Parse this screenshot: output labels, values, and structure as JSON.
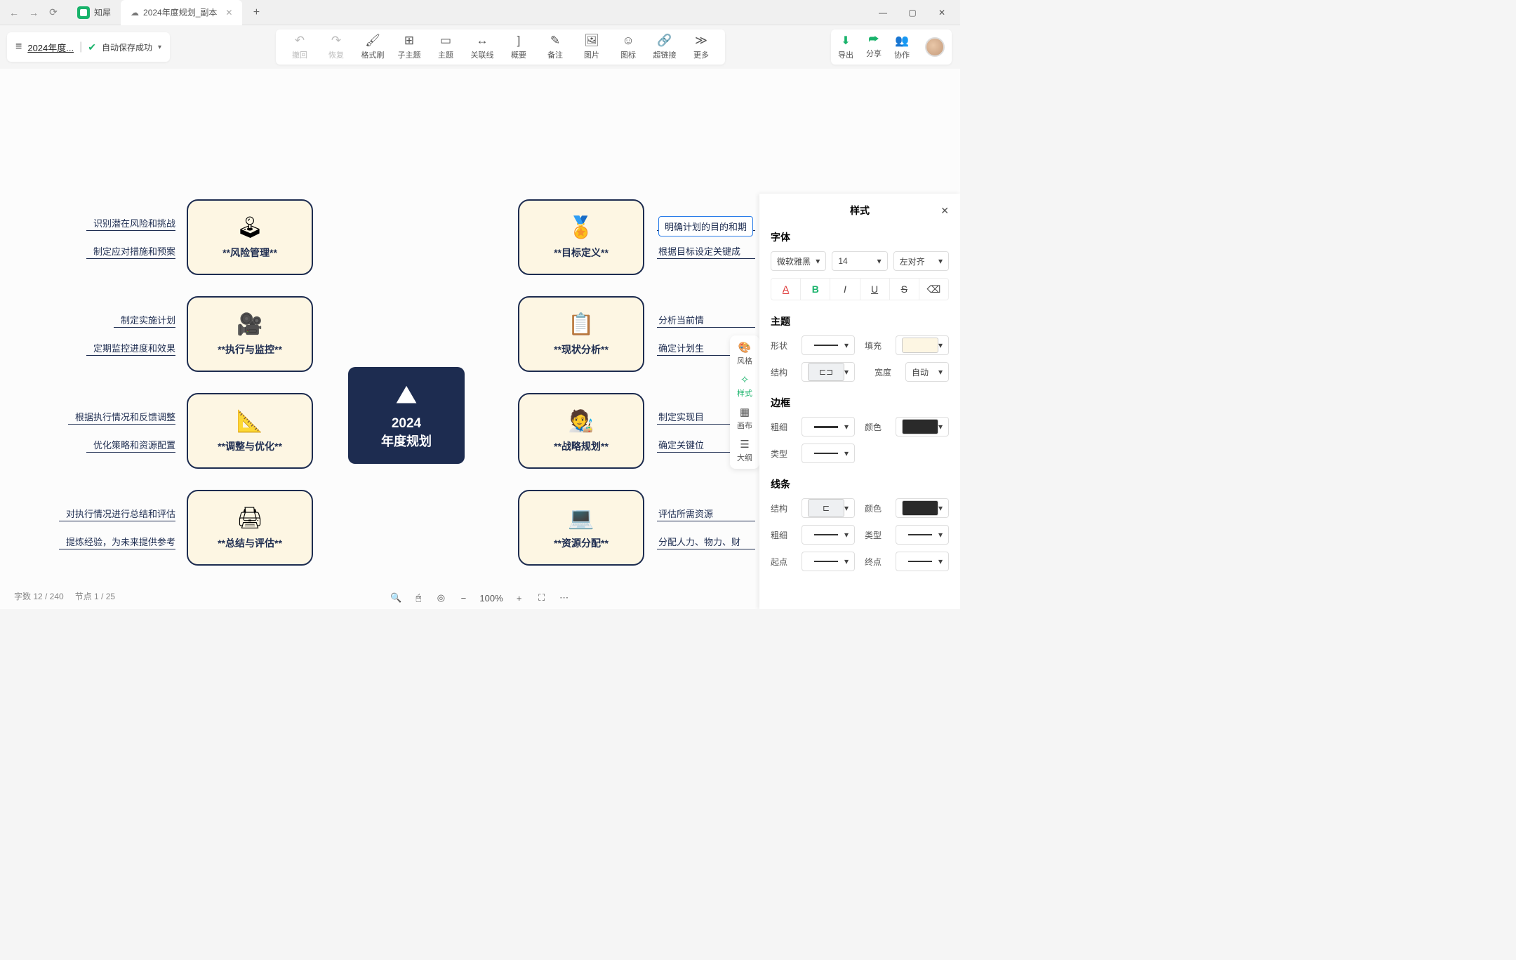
{
  "window": {
    "app_tab": "知犀",
    "doc_tab": "2024年度规划_副本",
    "nav": {
      "back": "←",
      "fwd": "→",
      "reload": "⟳",
      "add": "+"
    },
    "ctrl": {
      "min": "—",
      "max": "▢",
      "close": "✕"
    }
  },
  "doc_chip": {
    "title": "2024年度...",
    "autosave": "自动保存成功"
  },
  "toolbar": [
    {
      "id": "undo",
      "label": "撤回",
      "icon": "↶",
      "disabled": true
    },
    {
      "id": "redo",
      "label": "恢复",
      "icon": "↷",
      "disabled": true
    },
    {
      "id": "format-brush",
      "label": "格式刷",
      "icon": "🖌"
    },
    {
      "id": "subtopic",
      "label": "子主题",
      "icon": "⊞"
    },
    {
      "id": "topic",
      "label": "主题",
      "icon": "▭"
    },
    {
      "id": "relation",
      "label": "关联线",
      "icon": "↔"
    },
    {
      "id": "summary",
      "label": "概要",
      "icon": "]"
    },
    {
      "id": "note",
      "label": "备注",
      "icon": "✎"
    },
    {
      "id": "image",
      "label": "图片",
      "icon": "🖼"
    },
    {
      "id": "icon",
      "label": "图标",
      "icon": "☺"
    },
    {
      "id": "link",
      "label": "超链接",
      "icon": "🔗"
    },
    {
      "id": "more",
      "label": "更多",
      "icon": "≫"
    }
  ],
  "right_tools": [
    {
      "id": "export",
      "label": "导出",
      "icon": "⬇"
    },
    {
      "id": "share",
      "label": "分享",
      "icon": "⮫"
    },
    {
      "id": "collab",
      "label": "协作",
      "icon": "👥"
    }
  ],
  "mind": {
    "center": {
      "year": "2024",
      "sub": "年度规划",
      "icon": "⛰"
    },
    "right": [
      {
        "label": "**目标定义**",
        "icon": "🏅",
        "leaves": [
          "明确计划的目的和期",
          "根据目标设定关键成"
        ]
      },
      {
        "label": "**现状分析**",
        "icon": "📋",
        "leaves": [
          "分析当前情",
          "确定计划生"
        ]
      },
      {
        "label": "**战略规划**",
        "icon": "🧑‍🎨",
        "leaves": [
          "制定实现目",
          "确定关键位"
        ]
      },
      {
        "label": "**资源分配**",
        "icon": "💻",
        "leaves": [
          "评估所需资源",
          "分配人力、物力、财"
        ]
      }
    ],
    "left": [
      {
        "label": "**风险管理**",
        "icon": "🕹",
        "leaves": [
          "识别潜在风险和挑战",
          "制定应对措施和预案"
        ]
      },
      {
        "label": "**执行与监控**",
        "icon": "🎥",
        "leaves": [
          "制定实施计划",
          "定期监控进度和效果"
        ]
      },
      {
        "label": "**调整与优化**",
        "icon": "📐",
        "leaves": [
          "根据执行情况和反馈调整",
          "优化策略和资源配置"
        ]
      },
      {
        "label": "**总结与评估**",
        "icon": "🖨",
        "leaves": [
          "对执行情况进行总结和评估",
          "提炼经验，为未来提供参考"
        ]
      }
    ]
  },
  "side_tabs": [
    {
      "id": "style-theme",
      "label": "风格",
      "icon": "🎨"
    },
    {
      "id": "style",
      "label": "样式",
      "icon": "✧",
      "active": true
    },
    {
      "id": "canvas",
      "label": "画布",
      "icon": "▦"
    },
    {
      "id": "outline",
      "label": "大纲",
      "icon": "☰"
    }
  ],
  "panel": {
    "title": "样式",
    "font_section": "字体",
    "font_family": "微软雅黑",
    "font_size": "14",
    "align": "左对齐",
    "fmt": {
      "color": "A",
      "bold": "B",
      "italic": "I",
      "underline": "U",
      "strike": "S",
      "clear": "⌫"
    },
    "topic_section": "主题",
    "shape": "形状",
    "fill": "填充",
    "struct": "结构",
    "width": "宽度",
    "width_val": "自动",
    "border_section": "边框",
    "thick": "粗细",
    "color": "颜色",
    "type": "类型",
    "line_section": "线条",
    "start": "起点",
    "end": "终点"
  },
  "status": {
    "words": "字数 12 / 240",
    "nodes": "节点 1 / 25"
  },
  "zoom": {
    "value": "100%"
  }
}
